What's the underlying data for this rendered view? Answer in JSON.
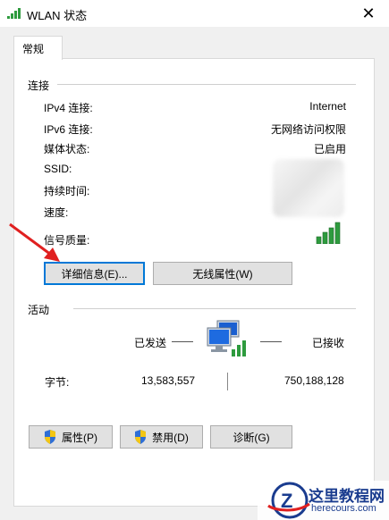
{
  "window": {
    "title": "WLAN 状态",
    "close_glyph": "✕"
  },
  "tab": {
    "label": "常规"
  },
  "connection": {
    "section_label": "连接",
    "rows": [
      {
        "label": "IPv4 连接:",
        "value": "Internet"
      },
      {
        "label": "IPv6 连接:",
        "value": "无网络访问权限"
      },
      {
        "label": "媒体状态:",
        "value": "已启用"
      },
      {
        "label": "SSID:",
        "value": ""
      },
      {
        "label": "持续时间:",
        "value": ""
      },
      {
        "label": "速度:",
        "value": ""
      },
      {
        "label": "信号质量:",
        "value": ""
      }
    ],
    "signal_icon": "signal-bars-icon"
  },
  "buttons_top": {
    "details": "详细信息(E)...",
    "wireless": "无线属性(W)"
  },
  "activity": {
    "section_label": "活动",
    "sent_label": "已发送",
    "received_label": "已接收",
    "bytes_label": "字节:",
    "bytes_sent": "13,583,557",
    "bytes_received": "750,188,128",
    "network_icon": "network-computers-icon"
  },
  "buttons_bottom": {
    "properties": "属性(P)",
    "disable": "禁用(D)",
    "diagnose": "诊断(G)"
  },
  "watermark": {
    "title": "这里教程网",
    "url": "herecours.com"
  },
  "colors": {
    "accent": "#0078d7",
    "signal_green": "#2e9b3e",
    "annotation_red": "#e02020",
    "watermark_blue": "#1a3c8f"
  }
}
